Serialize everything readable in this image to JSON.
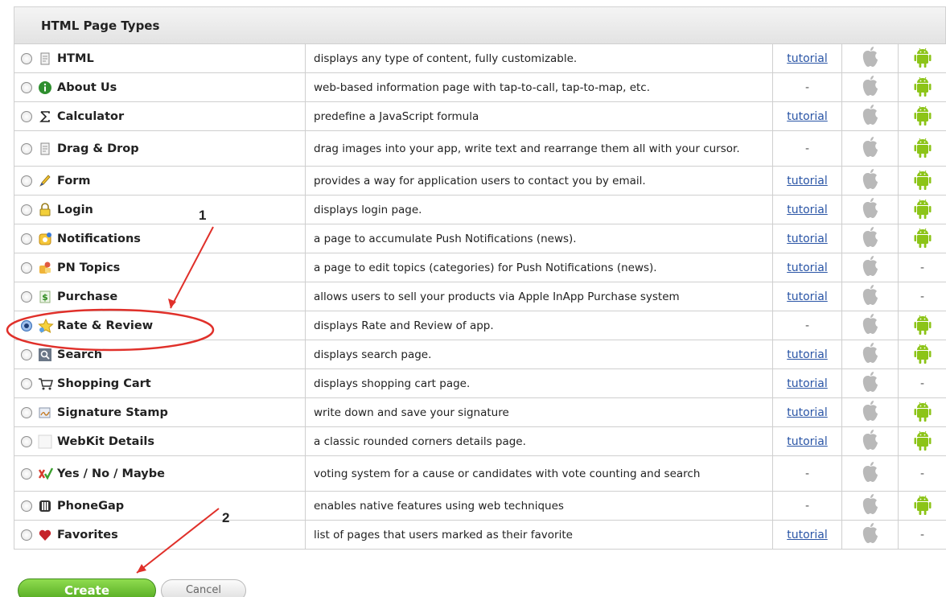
{
  "section": {
    "title": "HTML Page Types"
  },
  "rows": [
    {
      "icon": "document-icon",
      "name": "HTML",
      "desc": "displays any type of content, fully customizable.",
      "tutorial": "tutorial",
      "android": "yes"
    },
    {
      "icon": "info-icon",
      "name": "About Us",
      "desc": "web-based information page with tap-to-call, tap-to-map, etc.",
      "tutorial": "-",
      "android": "yes"
    },
    {
      "icon": "sigma-icon",
      "name": "Calculator",
      "desc": "predefine a JavaScript formula",
      "tutorial": "tutorial",
      "android": "yes"
    },
    {
      "icon": "document-icon",
      "name": "Drag & Drop",
      "desc": "drag images into your app, write text and rearrange them all with your cursor.",
      "tutorial": "-",
      "android": "yes"
    },
    {
      "icon": "pencil-icon",
      "name": "Form",
      "desc": "provides a way for application users to contact you by email.",
      "tutorial": "tutorial",
      "android": "yes"
    },
    {
      "icon": "lock-icon",
      "name": "Login",
      "desc": "displays login page.",
      "tutorial": "tutorial",
      "android": "yes"
    },
    {
      "icon": "notification-icon",
      "name": "Notifications",
      "desc": "a page to accumulate Push Notifications (news).",
      "tutorial": "tutorial",
      "android": "yes"
    },
    {
      "icon": "topics-icon",
      "name": "PN Topics",
      "desc": "a page to edit topics (categories) for Push Notifications (news).",
      "tutorial": "tutorial",
      "android": "-"
    },
    {
      "icon": "dollar-icon",
      "name": "Purchase",
      "desc": "allows users to sell your products via Apple InApp Purchase system",
      "tutorial": "tutorial",
      "android": "-"
    },
    {
      "icon": "star-icon",
      "name": "Rate & Review",
      "desc": "displays Rate and Review of app.",
      "tutorial": "-",
      "android": "yes",
      "selected": true
    },
    {
      "icon": "magnifier-icon",
      "name": "Search",
      "desc": "displays search page.",
      "tutorial": "tutorial",
      "android": "yes"
    },
    {
      "icon": "cart-icon",
      "name": "Shopping Cart",
      "desc": "displays shopping cart page.",
      "tutorial": "tutorial",
      "android": "-"
    },
    {
      "icon": "signature-icon",
      "name": "Signature Stamp",
      "desc": "write down and save your signature",
      "tutorial": "tutorial",
      "android": "yes"
    },
    {
      "icon": "blank-icon",
      "name": "WebKit Details",
      "desc": "a classic rounded corners details page.",
      "tutorial": "tutorial",
      "android": "yes"
    },
    {
      "icon": "vote-icon",
      "name": "Yes / No / Maybe",
      "desc": "voting system for a cause or candidates with vote counting and search",
      "tutorial": "-",
      "android": "-"
    },
    {
      "icon": "phonegap-icon",
      "name": "PhoneGap",
      "desc": "enables native features using web techniques",
      "tutorial": "-",
      "android": "yes"
    },
    {
      "icon": "heart-icon",
      "name": "Favorites",
      "desc": "list of pages that users marked as their favorite",
      "tutorial": "tutorial",
      "android": "-"
    }
  ],
  "buttons": {
    "create": "Create",
    "cancel": "Cancel"
  },
  "annotations": {
    "step1": "1",
    "step2": "2"
  },
  "colors": {
    "accent_green": "#4fa51d",
    "android_green": "#8cc418",
    "link_blue": "#2a55a6",
    "annotation_red": "#e0302a",
    "apple_gray": "#bdbdbd"
  }
}
